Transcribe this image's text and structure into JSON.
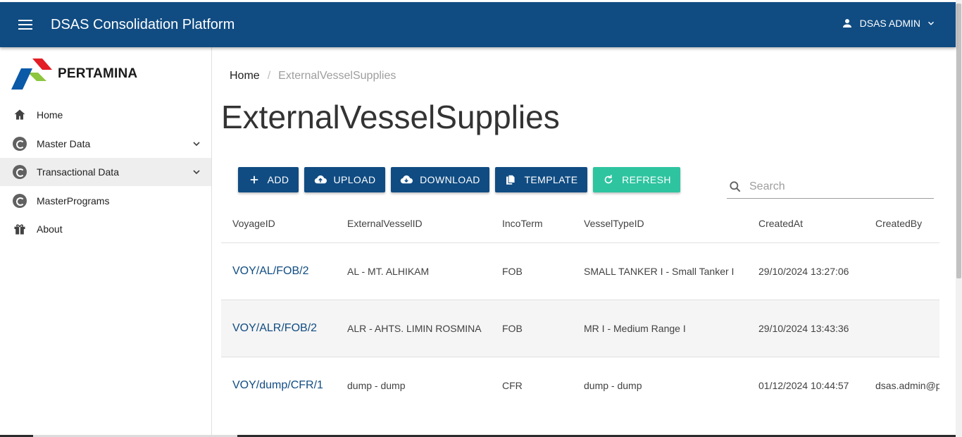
{
  "header": {
    "app_title": "DSAS Consolidation Platform",
    "user_name": "DSAS ADMIN"
  },
  "sidebar": {
    "logo_text": "PERTAMINA",
    "items": [
      {
        "label": "Home",
        "icon": "home-icon"
      },
      {
        "label": "Master Data",
        "icon": "sync-circle-icon",
        "expandable": true
      },
      {
        "label": "Transactional Data",
        "icon": "sync-circle-icon",
        "expandable": true,
        "active": true
      },
      {
        "label": "MasterPrograms",
        "icon": "sync-circle-icon"
      },
      {
        "label": "About",
        "icon": "gift-icon"
      }
    ]
  },
  "breadcrumb": {
    "home": "Home",
    "separator": "/",
    "current": "ExternalVesselSupplies"
  },
  "page_title": "ExternalVesselSupplies",
  "toolbar": {
    "add": "ADD",
    "upload": "UPLOAD",
    "download": "DOWNLOAD",
    "template": "TEMPLATE",
    "refresh": "REFRESH"
  },
  "search": {
    "placeholder": "Search",
    "value": ""
  },
  "table": {
    "columns": [
      "VoyageID",
      "ExternalVesselID",
      "IncoTerm",
      "VesselTypeID",
      "CreatedAt",
      "CreatedBy"
    ],
    "rows": [
      [
        "VOY/AL/FOB/2",
        "AL - MT. ALHIKAM",
        "FOB",
        "SMALL TANKER I - Small Tanker I",
        "29/10/2024 13:27:06",
        ""
      ],
      [
        "VOY/ALR/FOB/2",
        "ALR - AHTS. LIMIN ROSMINA",
        "FOB",
        "MR I - Medium Range I",
        "29/10/2024 13:43:36",
        ""
      ],
      [
        "VOY/dump/CFR/1",
        "dump - dump",
        "CFR",
        "dump - dump",
        "01/12/2024 10:44:57",
        "dsas.admin@p"
      ]
    ]
  },
  "colors": {
    "primary": "#104c82",
    "refresh": "#2ec4a0",
    "logo_red": "#e31e24",
    "logo_green": "#8dc63f",
    "logo_blue": "#0a5aa8"
  }
}
